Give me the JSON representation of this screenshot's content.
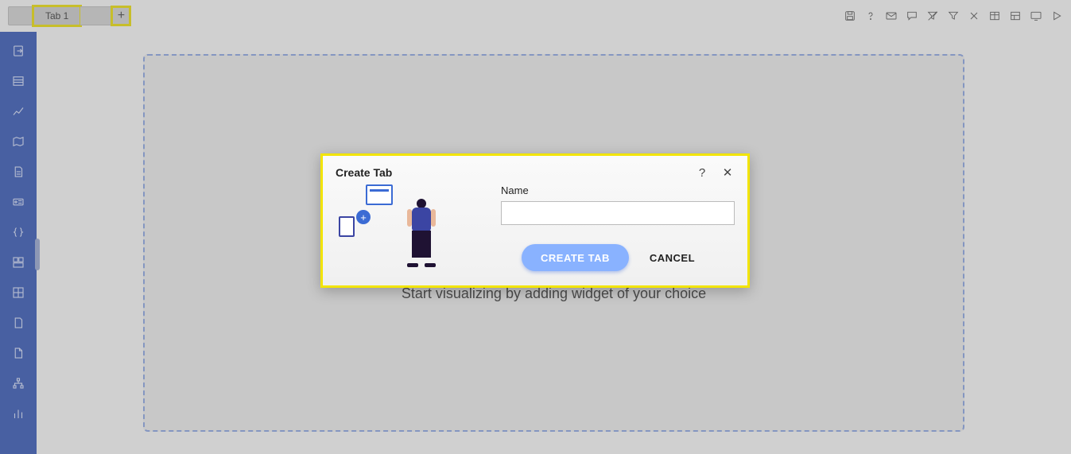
{
  "tabbar": {
    "tabs": [
      {
        "label": "Tab 1"
      }
    ],
    "add_label": "+"
  },
  "toolbar_icons": [
    "save-icon",
    "help-icon",
    "mail-icon",
    "comment-icon",
    "filter-off-icon",
    "filter-icon",
    "tools-icon",
    "table-icon",
    "layout-icon",
    "monitor-icon",
    "play-icon"
  ],
  "sidebar_icons": [
    "export-icon",
    "list-icon",
    "chart-line-icon",
    "map-icon",
    "document-icon",
    "card-icon",
    "braces-icon",
    "dashboard-icon",
    "grid-icon",
    "page-icon",
    "file-icon",
    "hierarchy-icon",
    "bar-chart-icon"
  ],
  "dropzone": {
    "message": "Start visualizing by adding widget of your choice"
  },
  "modal": {
    "title": "Create Tab",
    "help_glyph": "?",
    "close_glyph": "✕",
    "name_label": "Name",
    "name_value": "",
    "create_label": "CREATE TAB",
    "cancel_label": "CANCEL",
    "art_plus": "+"
  }
}
